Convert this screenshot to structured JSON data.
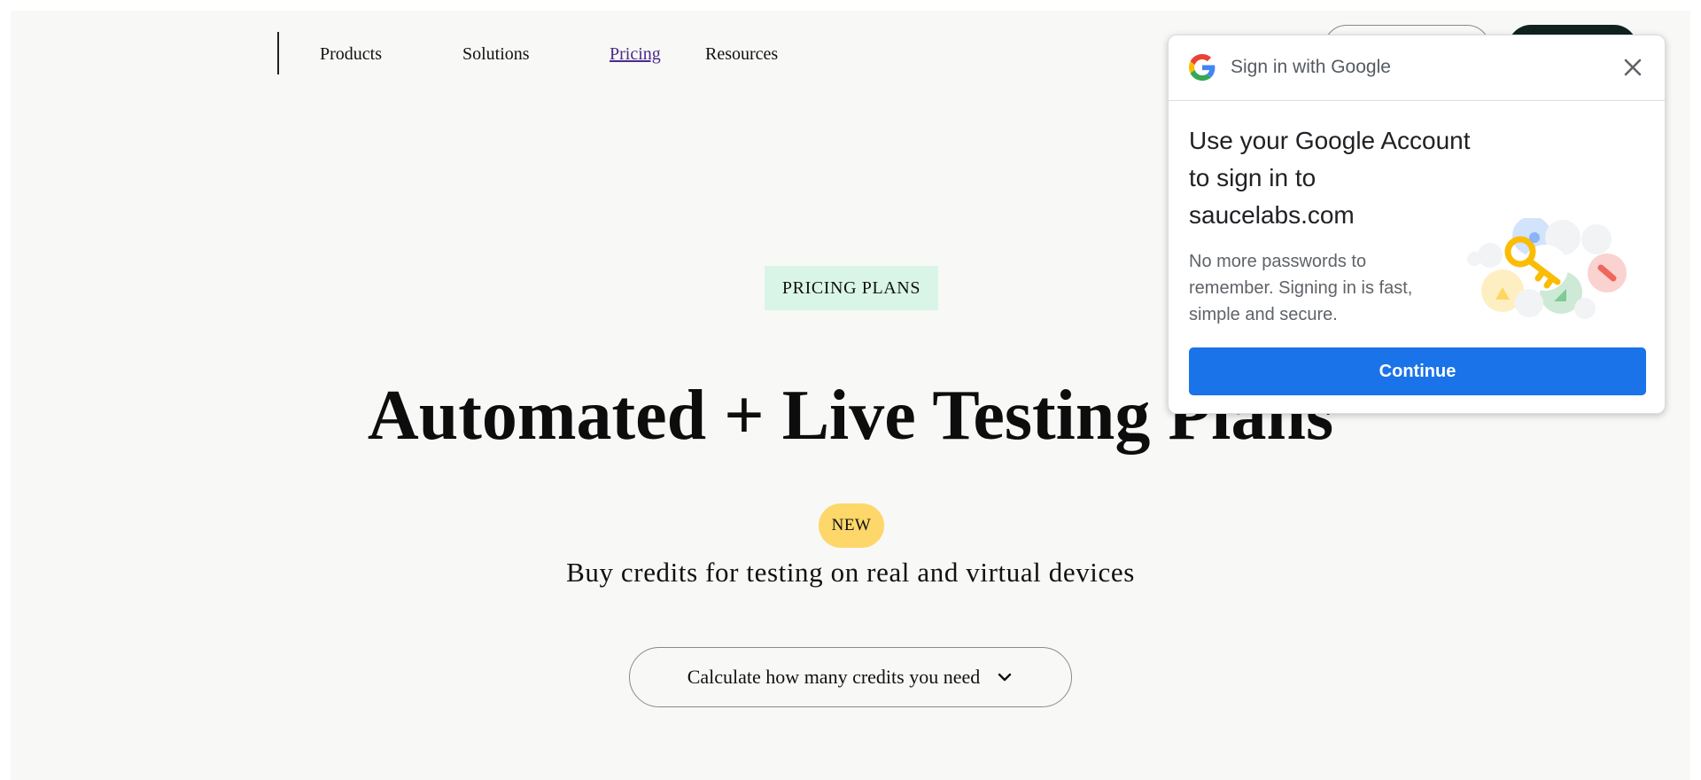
{
  "nav": {
    "items": [
      {
        "label": "Products"
      },
      {
        "label": "Solutions"
      },
      {
        "label": "Pricing"
      },
      {
        "label": "Resources"
      }
    ]
  },
  "hero": {
    "eyebrow": "PRICING PLANS",
    "title": "Automated + Live Testing Plans",
    "badge": "NEW",
    "subtitle": "Buy credits for testing on real and virtual devices",
    "calc_button": "Calculate how many credits you need",
    "calc_icon": "chevron-down-icon"
  },
  "google_popup": {
    "title": "Sign in with Google",
    "heading_lines": [
      "Use your Google Account",
      "to sign in to",
      "saucelabs.com"
    ],
    "description": "No more passwords to remember. Signing in is fast, simple and secure.",
    "continue_label": "Continue",
    "logo_icon": "google-logo-icon",
    "close_icon": "close-icon",
    "colors": {
      "continue_bg": "#1a73e8",
      "google_blue": "#4285F4",
      "google_red": "#EA4335",
      "google_yellow": "#FBBC05",
      "google_green": "#34A853"
    }
  },
  "colors": {
    "page_bg": "#f8f8f6",
    "eyebrow_bg": "#d9f5e8",
    "badge_bg": "#fdd76a",
    "active_link": "#4b2a8a"
  }
}
